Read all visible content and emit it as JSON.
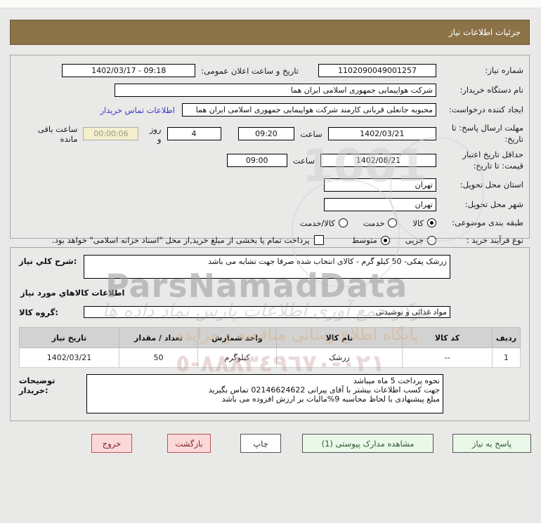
{
  "window": {
    "title": "جزئیات اطلاعات نیاز"
  },
  "form": {
    "need_number": {
      "label": "شماره نیاز:",
      "value": "1102090049001257"
    },
    "announce": {
      "label": "تاریخ و ساعت اعلان عمومی:",
      "value": "1402/03/17 - 09:18"
    },
    "buyer_org": {
      "label": "نام دستگاه خریدار:",
      "value": "شرکت هواپیمایی جمهوری اسلامی ایران هما"
    },
    "requester": {
      "label": "ایجاد کننده درخواست:",
      "value": "محبوبه جانعلی قربانی کارمند شرکت هواپیمایی جمهوری اسلامی ایران هما",
      "contact_link": "اطلاعات تماس خریدار"
    },
    "deadline": {
      "label": "مهلت ارسال پاسخ: تا تاریخ:",
      "date": "1402/03/21",
      "hour_label": "ساعت",
      "time": "09:20",
      "days": "4",
      "days_label": "روز و",
      "countdown": "00:00:06",
      "remaining_label": "ساعت باقی مانده"
    },
    "validity": {
      "label": "حداقل تاریخ اعتبار قیمت: تا تاریخ:",
      "date": "1402/08/21",
      "hour_label": "ساعت",
      "time": "09:00"
    },
    "province": {
      "label": "استان محل تحویل:",
      "value": "تهران"
    },
    "city": {
      "label": "شهر محل تحویل:",
      "value": "تهران"
    },
    "category": {
      "label": "طبقه بندی موضوعی:",
      "options": [
        {
          "label": "کالا",
          "selected": true
        },
        {
          "label": "خدمت",
          "selected": false
        },
        {
          "label": "کالا/خدمت",
          "selected": false
        }
      ]
    },
    "process": {
      "label": "نوع فرآیند خرید :",
      "options": [
        {
          "label": "جزیی",
          "selected": false
        },
        {
          "label": "متوسط",
          "selected": true
        }
      ],
      "checkbox_label": "پرداخت تمام یا بخشی از مبلغ خرید,از محل \"اسناد خزانه اسلامی\" خواهد بود.",
      "checkbox_checked": false
    }
  },
  "details": {
    "description": {
      "label": "شرح کلي نياز:",
      "value": "زرشک پفکی- 50 کیلو گرم - کالای انتخاب شده صرفا جهت تشابه می باشد"
    },
    "items_heading": "اطلاعات کالاهاي مورد نیاز",
    "group": {
      "label": "گروه کالا:",
      "value": "مواد غذائی و نوشیدنی"
    },
    "table": {
      "headers": [
        "ردیف",
        "کد کالا",
        "نام کالا",
        "واحد شمارش",
        "تعداد / مقدار",
        "تاریخ نیاز"
      ],
      "rows": [
        [
          "1",
          "--",
          "زرشک",
          "کیلوگرم",
          "50",
          "1402/03/21"
        ]
      ]
    },
    "notes": {
      "label": "توضیحات خریدار:",
      "lines": [
        "نحوه پرداخت 5 ماه میباشد",
        "جهت کسب اطلاعات بیشتر با آقای پیرانی 02146624622 تماس بگیرید",
        "مبلغ پیشنهادی با لحاظ محاسبه 9%مالیات بر ارزش افزوده می باشد"
      ]
    }
  },
  "buttons": {
    "exit": "خروج",
    "back": "بازگشت",
    "print": "چاپ",
    "attachments": "مشاهده مدارک پیوستی (1)",
    "respond": "پاسخ به نیاز"
  },
  "watermark": {
    "brand": "ParsNamadData",
    "script_line": "مرکز جمع آوری اطلاعات پارس نماد داده ها",
    "tagline": "پایگاه اطلاع رسانی مناقصه و مزایده",
    "phone": "٠٢١-٨٨٨٣٤٩٦٧٠-٥",
    "digits": "1001"
  },
  "colors": {
    "header": "#8c7347",
    "button_pink": "#fcd9d9",
    "button_green": "#eaf8ea",
    "countdown_bg": "#f3efcd",
    "link": "#3a3ace"
  }
}
